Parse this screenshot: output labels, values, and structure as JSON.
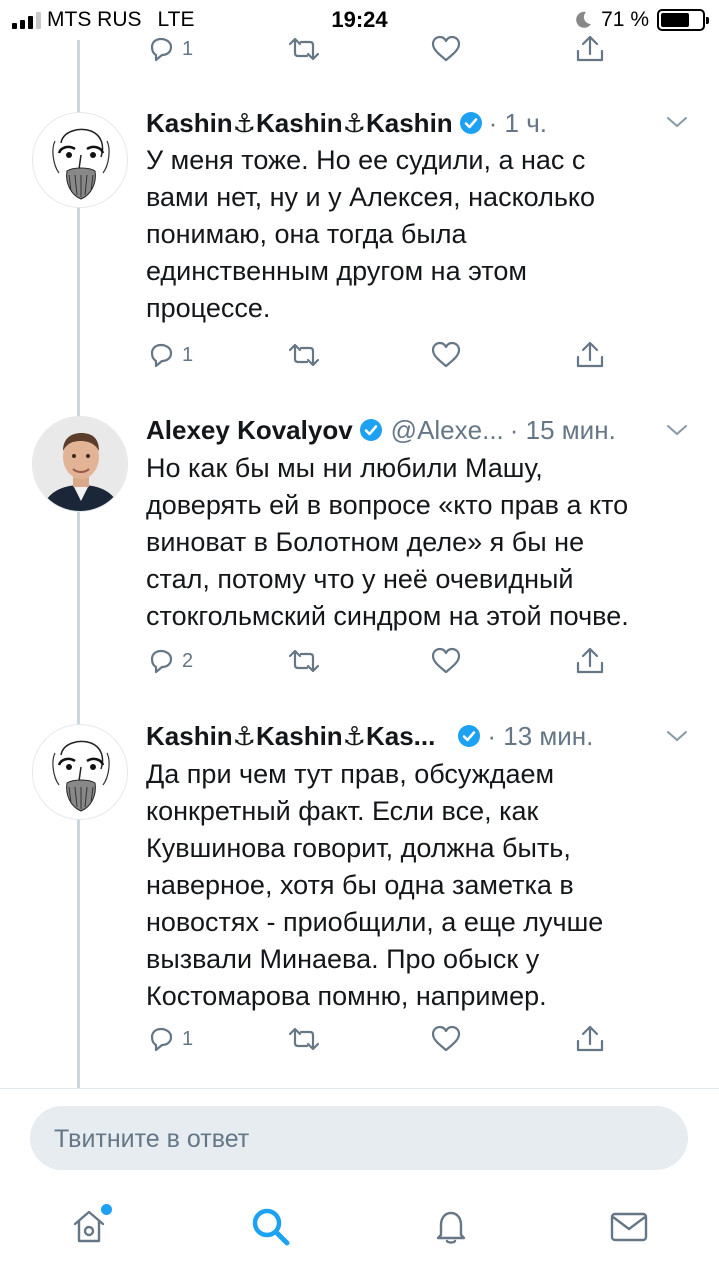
{
  "status_bar": {
    "carrier": "MTS RUS",
    "network": "LTE",
    "time": "19:24",
    "battery_percent": "71 %",
    "battery_level": 0.71
  },
  "top_actions": {
    "reply_count": "1"
  },
  "tweets": [
    {
      "name": "Kashin⚓Kashin⚓Kashin",
      "verified": true,
      "handle": "",
      "time": "· 1 ч.",
      "lines": [
        "У меня тоже. Но ее судили, а нас с",
        "вами нет, ну и у Алексея, насколько",
        "понимаю, она тогда была",
        "единственным другом на этом",
        "процессе."
      ],
      "reply_count": "1"
    },
    {
      "name": "Alexey Kovalyov",
      "verified": true,
      "handle": "@Alexe...",
      "time": "· 15 мин.",
      "lines": [
        "Но как бы мы ни любили Машу,",
        "доверять ей в вопросе «кто прав а кто",
        "виноват в Болотном деле» я бы не",
        "стал, потому что у неё очевидный",
        "стокгольмский синдром на этой почве."
      ],
      "reply_count": "2"
    },
    {
      "name": "Kashin⚓Kashin⚓Kas...",
      "verified": true,
      "handle": "",
      "time": "· 13 мин.",
      "lines": [
        "Да при чем тут прав, обсуждаем",
        "конкретный факт. Если все, как",
        "Кувшинова говорит, должна быть,",
        "наверное, хотя бы одна заметка в",
        "новостях - приобщили, а еще лучше",
        "вызвали Минаева. Про обыск у",
        "Костомарова помню, например."
      ],
      "reply_count": "1"
    }
  ],
  "reply_box": {
    "placeholder": "Твитните в ответ"
  },
  "tab_bar": {
    "items": [
      "home-icon",
      "search-icon",
      "bell-icon",
      "envelope-icon"
    ],
    "active": "search-icon",
    "has_new_home_dot": true
  },
  "colors": {
    "accent": "#1da1f2",
    "secondary_text": "#657786",
    "primary_text": "#14171a",
    "reply_box_bg": "#e6ecf0"
  }
}
